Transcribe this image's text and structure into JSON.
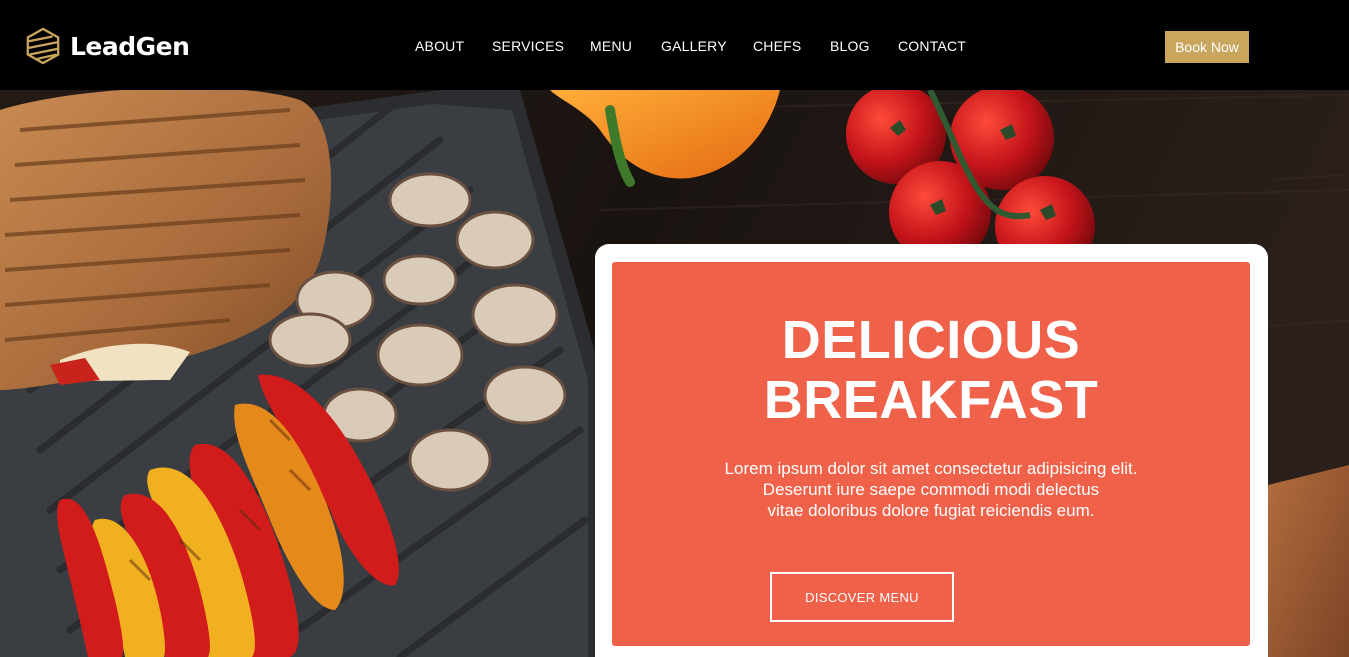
{
  "brand": {
    "name": "LeadGen",
    "accent": "#c9a55e"
  },
  "nav": {
    "items": [
      {
        "label": "ABOUT"
      },
      {
        "label": "SERVICES"
      },
      {
        "label": "MENU"
      },
      {
        "label": "GALLERY"
      },
      {
        "label": "CHEFS"
      },
      {
        "label": "BLOG"
      },
      {
        "label": "CONTACT"
      }
    ],
    "cta_label": "Book Now"
  },
  "hero": {
    "title_line1": "DELICIOUS",
    "title_line2": "BREAKFAST",
    "body_lines": [
      "Lorem ipsum dolor sit amet consectetur adipisicing elit.",
      "Deserunt iure saepe commodi modi delectus",
      "vitae doloribus dolore fugiat reiciendis eum."
    ],
    "button_label": "DISCOVER MENU",
    "card_color": "#f06149"
  }
}
